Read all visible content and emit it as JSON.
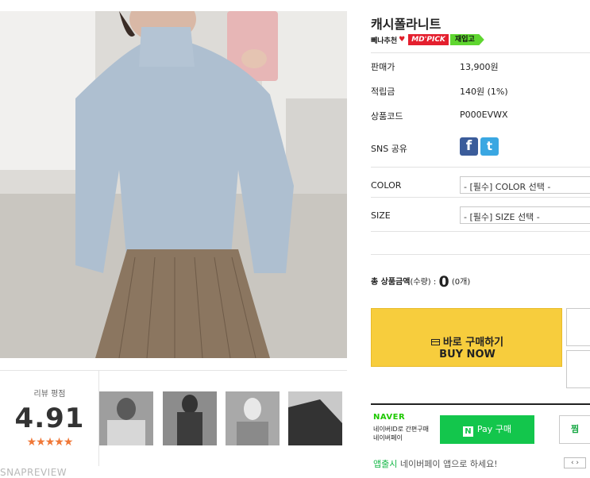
{
  "product": {
    "title": "캐시폴라니트",
    "badge_recommend": "뻬나추천",
    "badge_heart": "♥",
    "badge_md": "MD'PICK",
    "badge_restock": "재입고"
  },
  "info_rows": {
    "price_label": "판매가",
    "price_value": "13,900원",
    "points_label": "적립금",
    "points_value": "140원 (1%)",
    "code_label": "상품코드",
    "code_value": "P000EVWX",
    "sns_label": "SNS 공유",
    "facebook_glyph": "f",
    "twitter_glyph": "t"
  },
  "options": {
    "color_label": "COLOR",
    "color_select": "- [필수] COLOR 선택 -",
    "size_label": "SIZE",
    "size_select": "- [필수] SIZE 선택 -"
  },
  "total": {
    "label_bold": "총 상품금액",
    "label_qty": "(수량) :",
    "amount": "0",
    "count": "(0개)"
  },
  "buy": {
    "line1": "바로 구매하기",
    "line2": "BUY NOW"
  },
  "naver": {
    "logo": "NAVER",
    "desc1": "네이버ID로 간편구매",
    "desc2": "네이버페이",
    "npay_mark": "N",
    "npay_label": "Pay 구매",
    "jjim_label": "찜",
    "foot_green": "앱출시",
    "foot_text": " 네이버페이 앱으로 하세요!",
    "pager": "‹ ›"
  },
  "review": {
    "label": "리뷰 평점",
    "score": "4.91",
    "stars": "★★★★★",
    "brand": "SNAPREVIEW"
  },
  "colors": {
    "buy_button": "#f7cd3d",
    "npay_green": "#13c64c",
    "md_pick_red": "#e41f2e",
    "restock_green": "#5fd630",
    "star_orange": "#f07838",
    "facebook": "#3b5c9a",
    "twitter": "#3aa7e2"
  }
}
